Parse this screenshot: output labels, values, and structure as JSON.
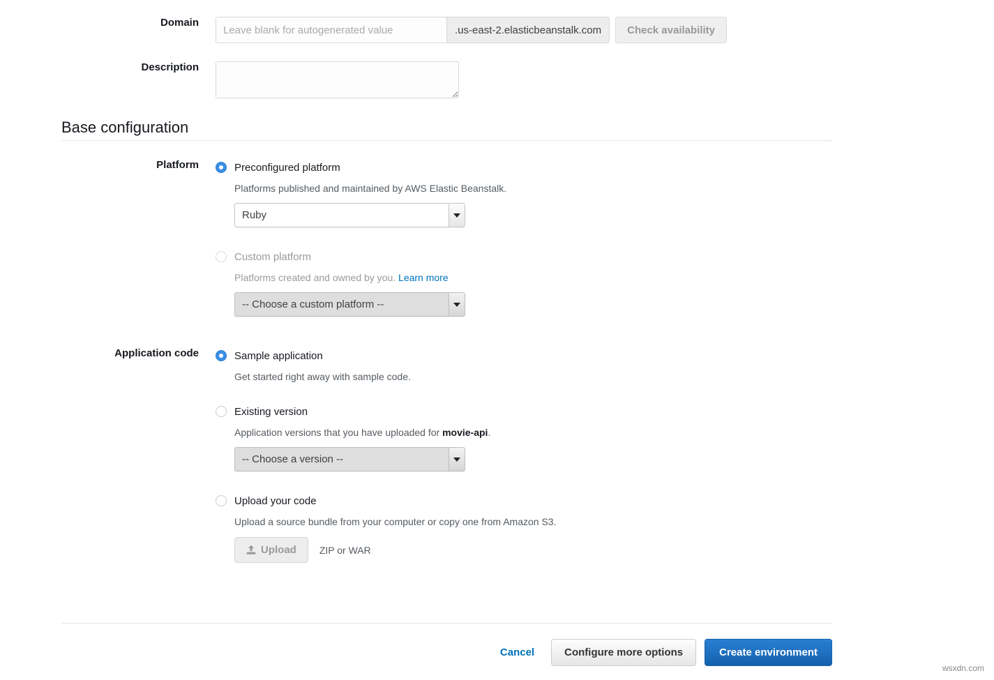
{
  "form": {
    "domain": {
      "label": "Domain",
      "placeholder": "Leave blank for autogenerated value",
      "value": "",
      "suffix": ".us-east-2.elasticbeanstalk.com",
      "check_button": "Check availability"
    },
    "description": {
      "label": "Description",
      "value": "",
      "placeholder": ""
    }
  },
  "base_configuration": {
    "heading": "Base configuration",
    "platform": {
      "label": "Platform",
      "options": [
        {
          "title": "Preconfigured platform",
          "description": "Platforms published and maintained by AWS Elastic Beanstalk.",
          "selected": true,
          "select_value": "Ruby"
        },
        {
          "title": "Custom platform",
          "description_prefix": "Platforms created and owned by you.",
          "link_label": "Learn more",
          "selected": false,
          "disabled": true,
          "select_value": "-- Choose a custom platform --"
        }
      ]
    },
    "application_code": {
      "label": "Application code",
      "options": [
        {
          "title": "Sample application",
          "description": "Get started right away with sample code.",
          "selected": true
        },
        {
          "title": "Existing version",
          "description_prefix": "Application versions that you have uploaded for",
          "description_bold": "movie-api",
          "description_suffix": ".",
          "selected": false,
          "select_value": "-- Choose a version --"
        },
        {
          "title": "Upload your code",
          "description": "Upload a source bundle from your computer or copy one from Amazon S3.",
          "selected": false,
          "upload_button": "Upload",
          "upload_hint": "ZIP or WAR"
        }
      ]
    }
  },
  "footer": {
    "cancel": "Cancel",
    "configure_more": "Configure more options",
    "create": "Create environment"
  },
  "watermark": "wsxdn.com",
  "colors": {
    "accent_blue": "#0073bb",
    "radio_blue": "#3a8ee6",
    "primary_button": "#1f72c6"
  }
}
